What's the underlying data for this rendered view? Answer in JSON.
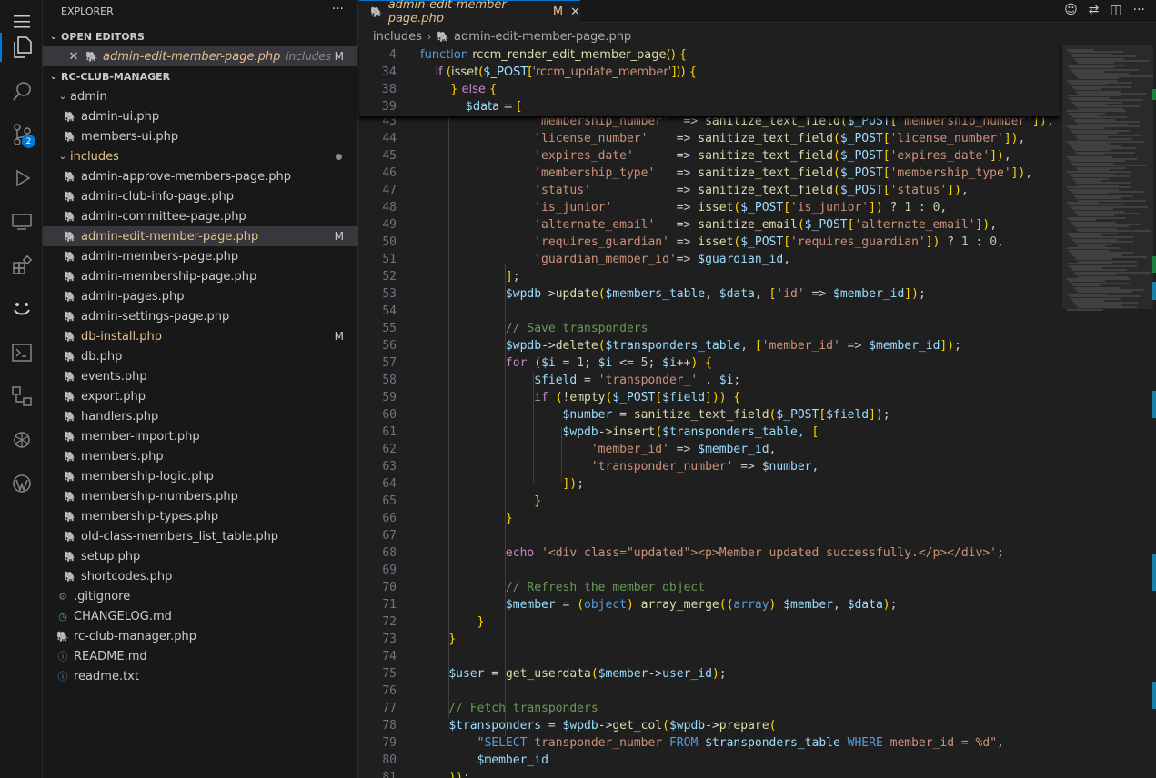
{
  "explorer": {
    "title": "EXPLORER",
    "more": "···",
    "open_editors": {
      "title": "OPEN EDITORS",
      "items": [
        {
          "name": "admin-edit-member-page.php",
          "desc": "includes",
          "status": "M"
        }
      ]
    },
    "project": {
      "title": "RC-CLUB-MANAGER",
      "admin_folder": "admin",
      "admin_files": [
        "admin-ui.php",
        "members-ui.php"
      ],
      "includes_folder": "includes",
      "includes_files": [
        {
          "name": "admin-approve-members-page.php"
        },
        {
          "name": "admin-club-info-page.php"
        },
        {
          "name": "admin-committee-page.php"
        },
        {
          "name": "admin-edit-member-page.php",
          "status": "M"
        },
        {
          "name": "admin-members-page.php"
        },
        {
          "name": "admin-membership-page.php"
        },
        {
          "name": "admin-pages.php"
        },
        {
          "name": "admin-settings-page.php"
        },
        {
          "name": "db-install.php",
          "status": "M"
        },
        {
          "name": "db.php"
        },
        {
          "name": "events.php"
        },
        {
          "name": "export.php"
        },
        {
          "name": "handlers.php"
        },
        {
          "name": "member-import.php"
        },
        {
          "name": "members.php"
        },
        {
          "name": "membership-logic.php"
        },
        {
          "name": "membership-numbers.php"
        },
        {
          "name": "membership-types.php"
        },
        {
          "name": "old-class-members_list_table.php"
        },
        {
          "name": "setup.php"
        },
        {
          "name": "shortcodes.php"
        }
      ],
      "root_files": [
        {
          "name": ".gitignore",
          "icon": "gear-icon"
        },
        {
          "name": "CHANGELOG.md",
          "icon": "clock-icon"
        },
        {
          "name": "rc-club-manager.php",
          "icon": "php-icon"
        },
        {
          "name": "README.md",
          "icon": "info-icon"
        },
        {
          "name": "readme.txt",
          "icon": "info-icon"
        }
      ]
    }
  },
  "activity_bar": {
    "source_control_badge": "2"
  },
  "tab": {
    "name": "admin-edit-member-page.php",
    "status": "M"
  },
  "breadcrumb": {
    "folder": "includes",
    "file": "admin-edit-member-page.php"
  },
  "sticky": [
    {
      "ln": "4",
      "code": "function rccm_render_edit_member_page() {"
    },
    {
      "ln": "34",
      "code": "    if (isset($_POST['rccm_update_member'])) {"
    },
    {
      "ln": "38",
      "code": "        } else {"
    },
    {
      "ln": "39",
      "code": "            $data = ["
    }
  ],
  "code_lines": [
    {
      "ln": "43",
      "code": "                'membership_number'  => sanitize_text_field($_POST['membership_number']),"
    },
    {
      "ln": "44",
      "code": "                'license_number'    => sanitize_text_field($_POST['license_number']),"
    },
    {
      "ln": "45",
      "code": "                'expires_date'      => sanitize_text_field($_POST['expires_date']),"
    },
    {
      "ln": "46",
      "code": "                'membership_type'   => sanitize_text_field($_POST['membership_type']),"
    },
    {
      "ln": "47",
      "code": "                'status'            => sanitize_text_field($_POST['status']),"
    },
    {
      "ln": "48",
      "code": "                'is_junior'         => isset($_POST['is_junior']) ? 1 : 0,"
    },
    {
      "ln": "49",
      "code": "                'alternate_email'   => sanitize_email($_POST['alternate_email']),"
    },
    {
      "ln": "50",
      "code": "                'requires_guardian' => isset($_POST['requires_guardian']) ? 1 : 0,"
    },
    {
      "ln": "51",
      "code": "                'guardian_member_id'=> $guardian_id,"
    },
    {
      "ln": "52",
      "code": "            ];"
    },
    {
      "ln": "53",
      "code": "            $wpdb->update($members_table, $data, ['id' => $member_id]);"
    },
    {
      "ln": "54",
      "code": ""
    },
    {
      "ln": "55",
      "code": "            // Save transponders"
    },
    {
      "ln": "56",
      "code": "            $wpdb->delete($transponders_table, ['member_id' => $member_id]);"
    },
    {
      "ln": "57",
      "code": "            for ($i = 1; $i <= 5; $i++) {"
    },
    {
      "ln": "58",
      "code": "                $field = 'transponder_' . $i;"
    },
    {
      "ln": "59",
      "code": "                if (!empty($_POST[$field])) {"
    },
    {
      "ln": "60",
      "code": "                    $number = sanitize_text_field($_POST[$field]);"
    },
    {
      "ln": "61",
      "code": "                    $wpdb->insert($transponders_table, ["
    },
    {
      "ln": "62",
      "code": "                        'member_id' => $member_id,"
    },
    {
      "ln": "63",
      "code": "                        'transponder_number' => $number,"
    },
    {
      "ln": "64",
      "code": "                    ]);"
    },
    {
      "ln": "65",
      "code": "                }"
    },
    {
      "ln": "66",
      "code": "            }"
    },
    {
      "ln": "67",
      "code": ""
    },
    {
      "ln": "68",
      "code": "            echo '<div class=\"updated\"><p>Member updated successfully.</p></div>';"
    },
    {
      "ln": "69",
      "code": ""
    },
    {
      "ln": "70",
      "code": "            // Refresh the member object"
    },
    {
      "ln": "71",
      "code": "            $member = (object) array_merge((array) $member, $data);"
    },
    {
      "ln": "72",
      "code": "        }"
    },
    {
      "ln": "73",
      "code": "    }"
    },
    {
      "ln": "74",
      "code": ""
    },
    {
      "ln": "75",
      "code": "    $user = get_userdata($member->user_id);"
    },
    {
      "ln": "76",
      "code": ""
    },
    {
      "ln": "77",
      "code": "    // Fetch transponders"
    },
    {
      "ln": "78",
      "code": "    $transponders = $wpdb->get_col($wpdb->prepare("
    },
    {
      "ln": "79",
      "code": "        \"SELECT transponder_number FROM $transponders_table WHERE member_id = %d\","
    },
    {
      "ln": "80",
      "code": "        $member_id"
    },
    {
      "ln": "81",
      "code": "    ));"
    }
  ],
  "colors": {
    "accent": "#0078d4",
    "modified": "#e2c08d",
    "php_icon": "#a074c4"
  }
}
